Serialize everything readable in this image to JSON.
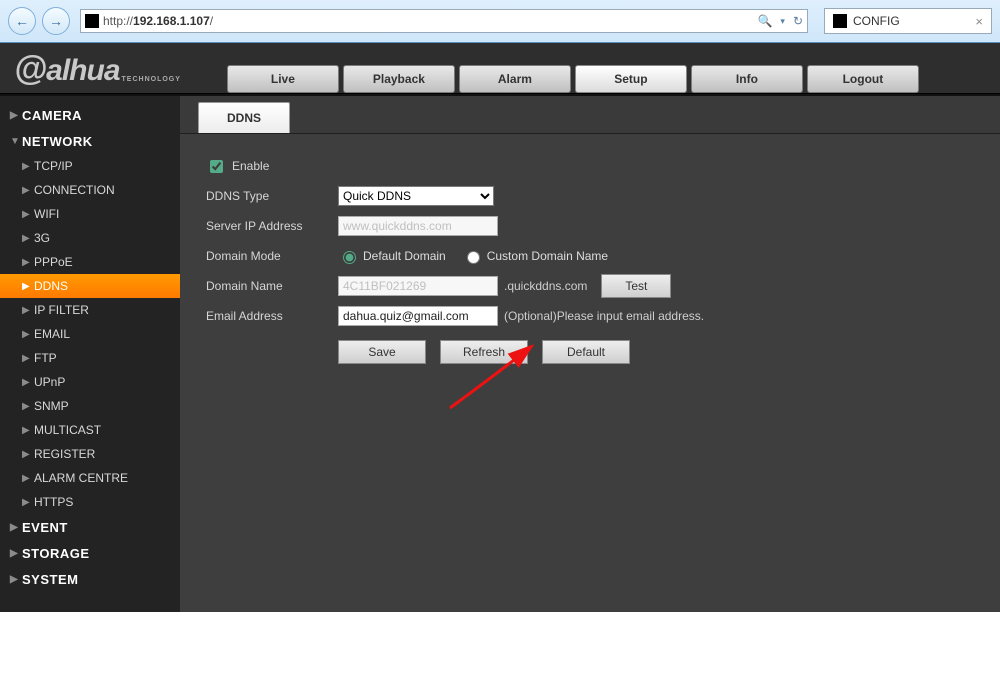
{
  "browser": {
    "url_prefix": "http://",
    "url_host": "192.168.1.107",
    "url_suffix": "/",
    "tab_title": "CONFIG"
  },
  "topnav": {
    "tabs": [
      "Live",
      "Playback",
      "Alarm",
      "Setup",
      "Info",
      "Logout"
    ],
    "active_index": 3
  },
  "sidebar": {
    "groups": [
      {
        "label": "CAMERA",
        "open": false,
        "items": []
      },
      {
        "label": "NETWORK",
        "open": true,
        "items": [
          "TCP/IP",
          "CONNECTION",
          "WIFI",
          "3G",
          "PPPoE",
          "DDNS",
          "IP FILTER",
          "EMAIL",
          "FTP",
          "UPnP",
          "SNMP",
          "MULTICAST",
          "REGISTER",
          "ALARM CENTRE",
          "HTTPS"
        ],
        "active_item_index": 5
      },
      {
        "label": "EVENT",
        "open": false,
        "items": []
      },
      {
        "label": "STORAGE",
        "open": false,
        "items": []
      },
      {
        "label": "SYSTEM",
        "open": false,
        "items": []
      }
    ]
  },
  "panel": {
    "tab_label": "DDNS",
    "enable_label": "Enable",
    "enable_checked": true,
    "rows": {
      "ddns_type": {
        "label": "DDNS Type",
        "value": "Quick DDNS"
      },
      "server_ip": {
        "label": "Server IP Address",
        "value": "www.quickddns.com"
      },
      "domain_mode": {
        "label": "Domain Mode",
        "options": [
          "Default Domain",
          "Custom Domain Name"
        ],
        "selected_index": 0
      },
      "domain_name": {
        "label": "Domain Name",
        "value": "4C11BF021269",
        "suffix": ".quickddns.com",
        "test_btn": "Test"
      },
      "email": {
        "label": "Email Address",
        "value": "dahua.quiz@gmail.com",
        "hint": "(Optional)Please input email address."
      }
    },
    "buttons": {
      "save": "Save",
      "refresh": "Refresh",
      "default": "Default"
    }
  },
  "logo": {
    "brand": "alhua",
    "sub": "TECHNOLOGY"
  }
}
